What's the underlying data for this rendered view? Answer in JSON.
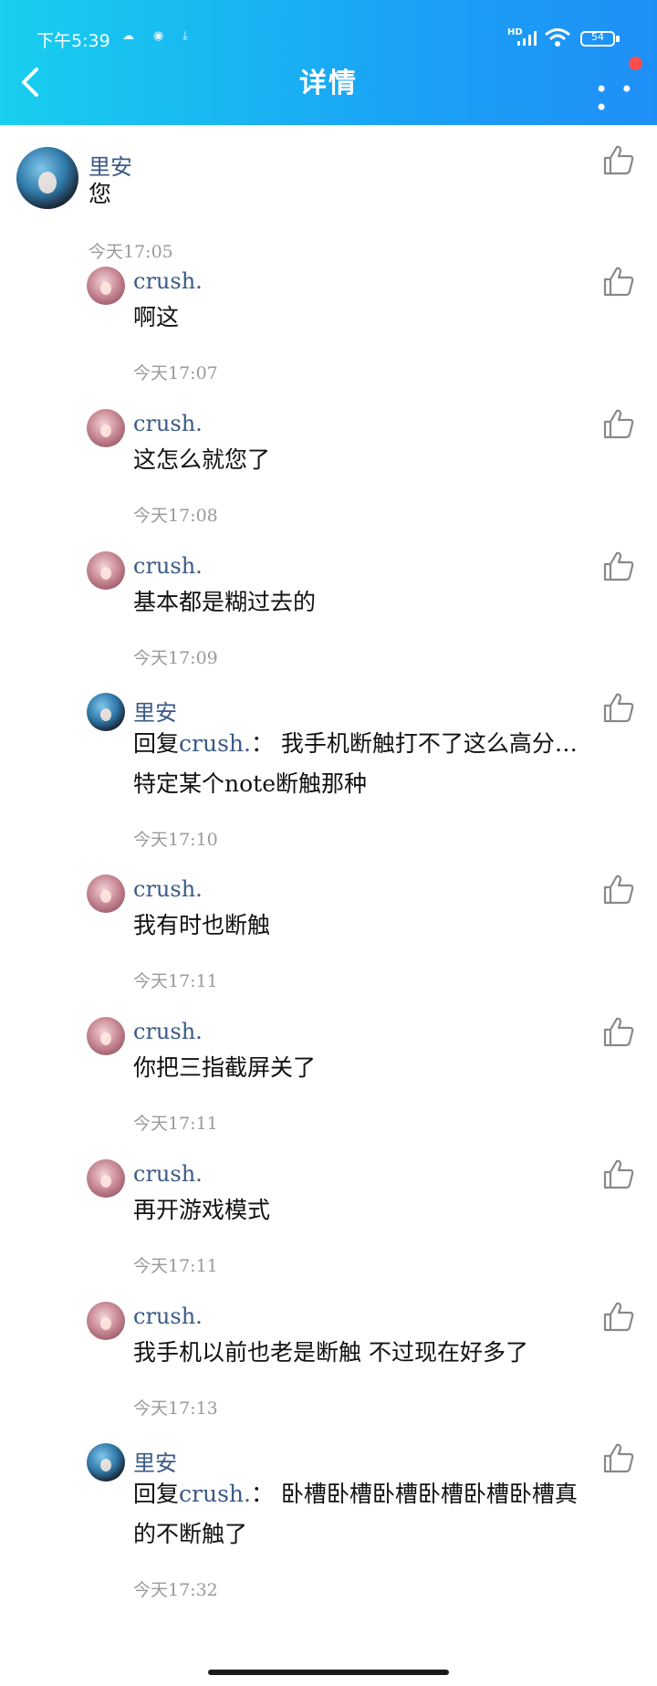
{
  "status_bar": {
    "time": "下午5:39",
    "battery": "54"
  },
  "header": {
    "title": "详情"
  },
  "comments": [
    {
      "user": "里安",
      "content": "您",
      "time": "今天17:05",
      "avatar": "blue-hair-avatar"
    },
    {
      "user": "crush.",
      "content": "啊这",
      "time": "今天17:07",
      "avatar": "pink-avatar"
    },
    {
      "user": "crush.",
      "content": "这怎么就您了",
      "time": "今天17:08",
      "avatar": "pink-avatar"
    },
    {
      "user": "crush.",
      "content": "基本都是糊过去的",
      "time": "今天17:09",
      "avatar": "pink-avatar"
    },
    {
      "user": "里安",
      "reply_prefix": "回复",
      "reply_to": "crush.",
      "content": "：  我手机断触打不了这么高分…",
      "content_line2": "特定某个note断触那种",
      "time": "今天17:10",
      "avatar": "blue-hair-avatar"
    },
    {
      "user": "crush.",
      "content": "我有时也断触",
      "time": "今天17:11",
      "avatar": "pink-avatar"
    },
    {
      "user": "crush.",
      "content": "你把三指截屏关了",
      "time": "今天17:11",
      "avatar": "pink-avatar"
    },
    {
      "user": "crush.",
      "content": "再开游戏模式",
      "time": "今天17:11",
      "avatar": "pink-avatar"
    },
    {
      "user": "crush.",
      "content": "我手机以前也老是断触 不过现在好多了",
      "time": "今天17:13",
      "avatar": "pink-avatar"
    },
    {
      "user": "里安",
      "reply_prefix": "回复",
      "reply_to": "crush.",
      "content": "：  卧槽卧槽卧槽卧槽卧槽卧槽真",
      "content_line2": "的不断触了",
      "time": "今天17:32",
      "avatar": "blue-hair-avatar"
    }
  ],
  "icons": {
    "back": "chevron-left-icon",
    "more": "more-dots-icon",
    "like": "thumbs-up-icon"
  },
  "colors": {
    "header_gradient_start": "#18cfee",
    "header_gradient_end": "#1e8ff7",
    "username": "#3b5a86",
    "timestamp": "#9a9a9a",
    "notification_dot": "#ff4d4f"
  }
}
